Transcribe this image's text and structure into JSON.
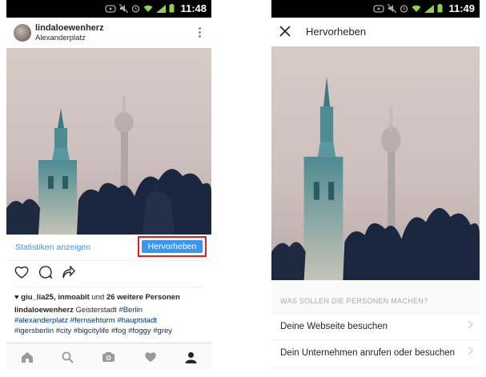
{
  "left_screen": {
    "status_time": "11:48",
    "post": {
      "username": "lindaloewenherz",
      "location": "Alexanderplatz",
      "stats_link": "Statistiken anzeigen",
      "promote_button": "Hervorheben",
      "likes": {
        "names": "giu_lia25, inmoabit",
        "conjunction": "und",
        "others": "26 weitere Personen"
      },
      "caption": {
        "author": "lindaloewenherz",
        "text": "Geisterstadt",
        "tag_berlin": "#Berlin",
        "tag_alexanderplatz": "#alexanderplatz",
        "tag_fernsehturm": "#fernsehturm",
        "tag_hauptstadt": "#hauptstadt",
        "tag_igersberlin": "#igersberlin",
        "tag_city": "#city",
        "tag_bigcitylife": "#bigcitylife",
        "tag_fog": "#fog",
        "tag_foggy": "#foggy",
        "tag_grey": "#grey"
      }
    },
    "bottom_nav": [
      "home-icon",
      "search-icon",
      "camera-icon",
      "heart-icon",
      "profile-icon"
    ]
  },
  "right_screen": {
    "status_time": "11:49",
    "title": "Hervorheben",
    "section_label": "WAS SOLLEN DIE PERSONEN MACHEN?",
    "options": [
      {
        "label": "Deine Webseite besuchen"
      },
      {
        "label": "Dein Unternehmen anrufen oder besuchen"
      }
    ]
  },
  "colors": {
    "accent_blue": "#3897f0",
    "highlight_red": "#e0201f",
    "hashtag": "#003569"
  }
}
